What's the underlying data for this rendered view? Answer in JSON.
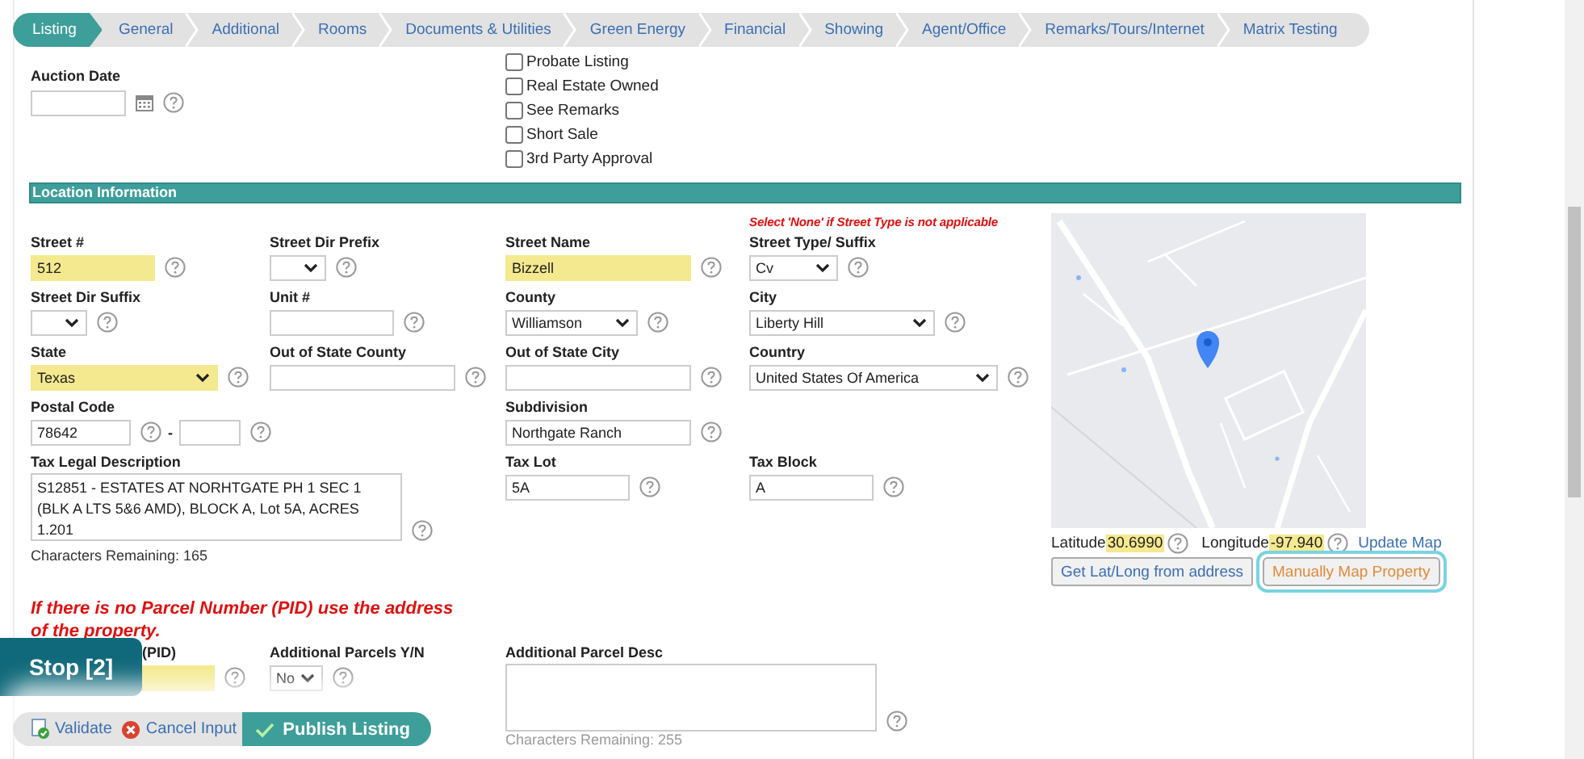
{
  "tabs": [
    {
      "label": "Listing",
      "selected": true
    },
    {
      "label": "General",
      "selected": false
    },
    {
      "label": "Additional",
      "selected": false
    },
    {
      "label": "Rooms",
      "selected": false
    },
    {
      "label": "Documents & Utilities",
      "selected": false
    },
    {
      "label": "Green Energy",
      "selected": false
    },
    {
      "label": "Financial",
      "selected": false
    },
    {
      "label": "Showing",
      "selected": false
    },
    {
      "label": "Agent/Office",
      "selected": false
    },
    {
      "label": "Remarks/Tours/Internet",
      "selected": false
    },
    {
      "label": "Matrix Testing",
      "selected": false
    }
  ],
  "auction": {
    "label": "Auction Date"
  },
  "flags": [
    {
      "label": "Probate Listing",
      "checked": false
    },
    {
      "label": "Real Estate Owned",
      "checked": false
    },
    {
      "label": "See Remarks",
      "checked": false
    },
    {
      "label": "Short Sale",
      "checked": false
    },
    {
      "label": "3rd Party Approval",
      "checked": false
    }
  ],
  "location": {
    "header": "Location Information",
    "note": "Select 'None' if Street Type is not applicable",
    "fields": [
      {
        "label": "Street #",
        "kind": "text",
        "value": "512",
        "required": true
      },
      {
        "label": "Street Dir Prefix",
        "kind": "select",
        "required": false
      },
      {
        "label": "Street Name",
        "kind": "text",
        "value": "Bizzell",
        "required": true
      },
      {
        "label": "Street Type/ Suffix",
        "kind": "select",
        "value": "Cv",
        "required": false
      },
      {
        "label": "Street Dir Suffix",
        "kind": "select",
        "required": false
      },
      {
        "label": "Unit #",
        "kind": "text",
        "required": false
      },
      {
        "label": "County",
        "kind": "select",
        "value": "Williamson",
        "required": false
      },
      {
        "label": "City",
        "kind": "select",
        "value": "Liberty Hill",
        "required": false
      },
      {
        "label": "State",
        "kind": "select",
        "value": "Texas",
        "required": true
      },
      {
        "label": "Out of State County",
        "kind": "text",
        "required": false
      },
      {
        "label": "Out of State City",
        "kind": "text",
        "required": false
      },
      {
        "label": "Country",
        "kind": "select",
        "value": "United States Of America",
        "required": false
      },
      {
        "label": "Postal Code",
        "kind": "postal",
        "value": "78642",
        "separator": "-",
        "required": false
      },
      {
        "label": "Subdivision",
        "kind": "text",
        "value": "Northgate Ranch",
        "required": false
      },
      {
        "label": "Tax Legal Description",
        "kind": "textarea",
        "value": "S12851 - ESTATES AT NORHTGATE PH 1 SEC 1 (BLK A LTS 5&6 AMD), BLOCK A, Lot 5A, ACRES 1.201",
        "counter": "Characters Remaining: 165",
        "required": false
      },
      {
        "label": "Tax Lot",
        "kind": "text",
        "value": "5A",
        "required": false
      },
      {
        "label": "Tax Block",
        "kind": "text",
        "value": "A",
        "required": false
      }
    ]
  },
  "map": {
    "kind": "picture",
    "latitude_label": "Latitude",
    "latitude": "30.6990",
    "longitude_label": "Longitude",
    "longitude": "-97.940",
    "update_link": "Update Map",
    "buttons": [
      {
        "label": "Get Lat/Long from address",
        "kind": "lookup",
        "focused": false
      },
      {
        "label": "Manually Map Property",
        "kind": "manual",
        "focused": true
      }
    ]
  },
  "parcel": {
    "note": "If there is no Parcel Number (PID) use the address of the property.",
    "fields": [
      {
        "label": "(PID)",
        "kind": "text",
        "required": true
      },
      {
        "label": "Additional Parcels Y/N",
        "kind": "select",
        "value": "No",
        "required": false
      },
      {
        "label": "Additional Parcel Desc",
        "kind": "textarea",
        "counter": "Characters Remaining: 255",
        "required": false
      }
    ]
  },
  "toolbar": {
    "stop": "Stop [2]",
    "actions": [
      {
        "label": "Validate",
        "kind": "validate"
      },
      {
        "label": "Cancel Input",
        "kind": "cancel"
      },
      {
        "label": "Publish Listing",
        "kind": "publish"
      }
    ]
  }
}
